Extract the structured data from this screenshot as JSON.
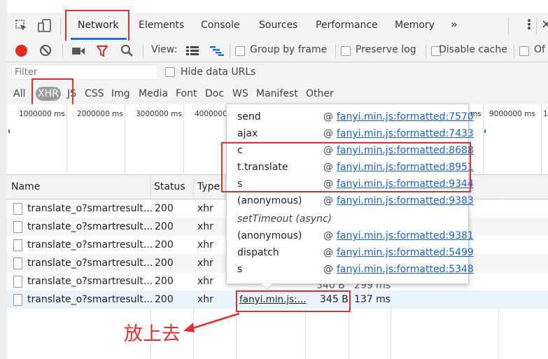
{
  "devtools": {
    "tabs": [
      "Network",
      "Elements",
      "Console",
      "Sources",
      "Performance",
      "Memory"
    ],
    "more_tabs": "»",
    "menu_glyph": "⋮",
    "close_glyph": "×"
  },
  "toolbar": {
    "view_label": "View:",
    "group_by_frame": "Group by frame",
    "preserve_log": "Preserve log",
    "disable_cache": "Disable cache",
    "offline_partial": "Of"
  },
  "filter": {
    "placeholder": "Filter",
    "hide_data_urls": "Hide data URLs",
    "types": [
      "All",
      "XHR",
      "JS",
      "CSS",
      "Img",
      "Media",
      "Font",
      "Doc",
      "WS",
      "Manifest",
      "Other"
    ]
  },
  "overview": {
    "ticks": [
      "1000000 ms",
      "2000000 ms",
      "3000000 ms",
      "4000000",
      "ms",
      "9000000 ms",
      "1"
    ]
  },
  "table": {
    "headers": {
      "name": "Name",
      "status": "Status",
      "type": "Type"
    },
    "rows": [
      {
        "name": "translate_o?smartresult...",
        "status": "200",
        "type": "xhr"
      },
      {
        "name": "translate_o?smartresult...",
        "status": "200",
        "type": "xhr"
      },
      {
        "name": "translate_o?smartresult...",
        "status": "200",
        "type": "xhr"
      },
      {
        "name": "translate_o?smartresult...",
        "status": "200",
        "type": "xhr"
      },
      {
        "name": "translate_o?smartresult...",
        "status": "200",
        "type": "xhr",
        "size_partial": "340 B",
        "time_partial": "299 ms"
      },
      {
        "name": "translate_o?smartresult...",
        "status": "200",
        "type": "xhr",
        "initiator": "fanyi.min.js:...",
        "size": "345 B",
        "time": "137 ms"
      }
    ]
  },
  "initiator_popup": {
    "items": [
      {
        "fn": "send",
        "link": "fanyi.min.js:formatted:7570"
      },
      {
        "fn": "ajax",
        "link": "fanyi.min.js:formatted:7433"
      },
      {
        "fn": "c",
        "link": "fanyi.min.js:formatted:8688"
      },
      {
        "fn": "t.translate",
        "link": "fanyi.min.js:formatted:8951"
      },
      {
        "fn": "s",
        "link": "fanyi.min.js:formatted:9344"
      },
      {
        "fn": "(anonymous)",
        "link": "fanyi.min.js:formatted:9383"
      },
      {
        "async": "setTimeout (async)"
      },
      {
        "fn": "(anonymous)",
        "link": "fanyi.min.js:formatted:9381"
      },
      {
        "fn": "dispatch",
        "link": "fanyi.min.js:formatted:5499"
      },
      {
        "fn": "s",
        "link": "fanyi.min.js:formatted:5348"
      }
    ],
    "at": "@"
  },
  "annotation": {
    "text": "放上去",
    "color": "#e03131"
  },
  "colors": {
    "record_red": "#e8271f",
    "filter_icon_red": "#d93025",
    "link_blue": "#1a5fd0",
    "annotation_red": "#e03131"
  }
}
